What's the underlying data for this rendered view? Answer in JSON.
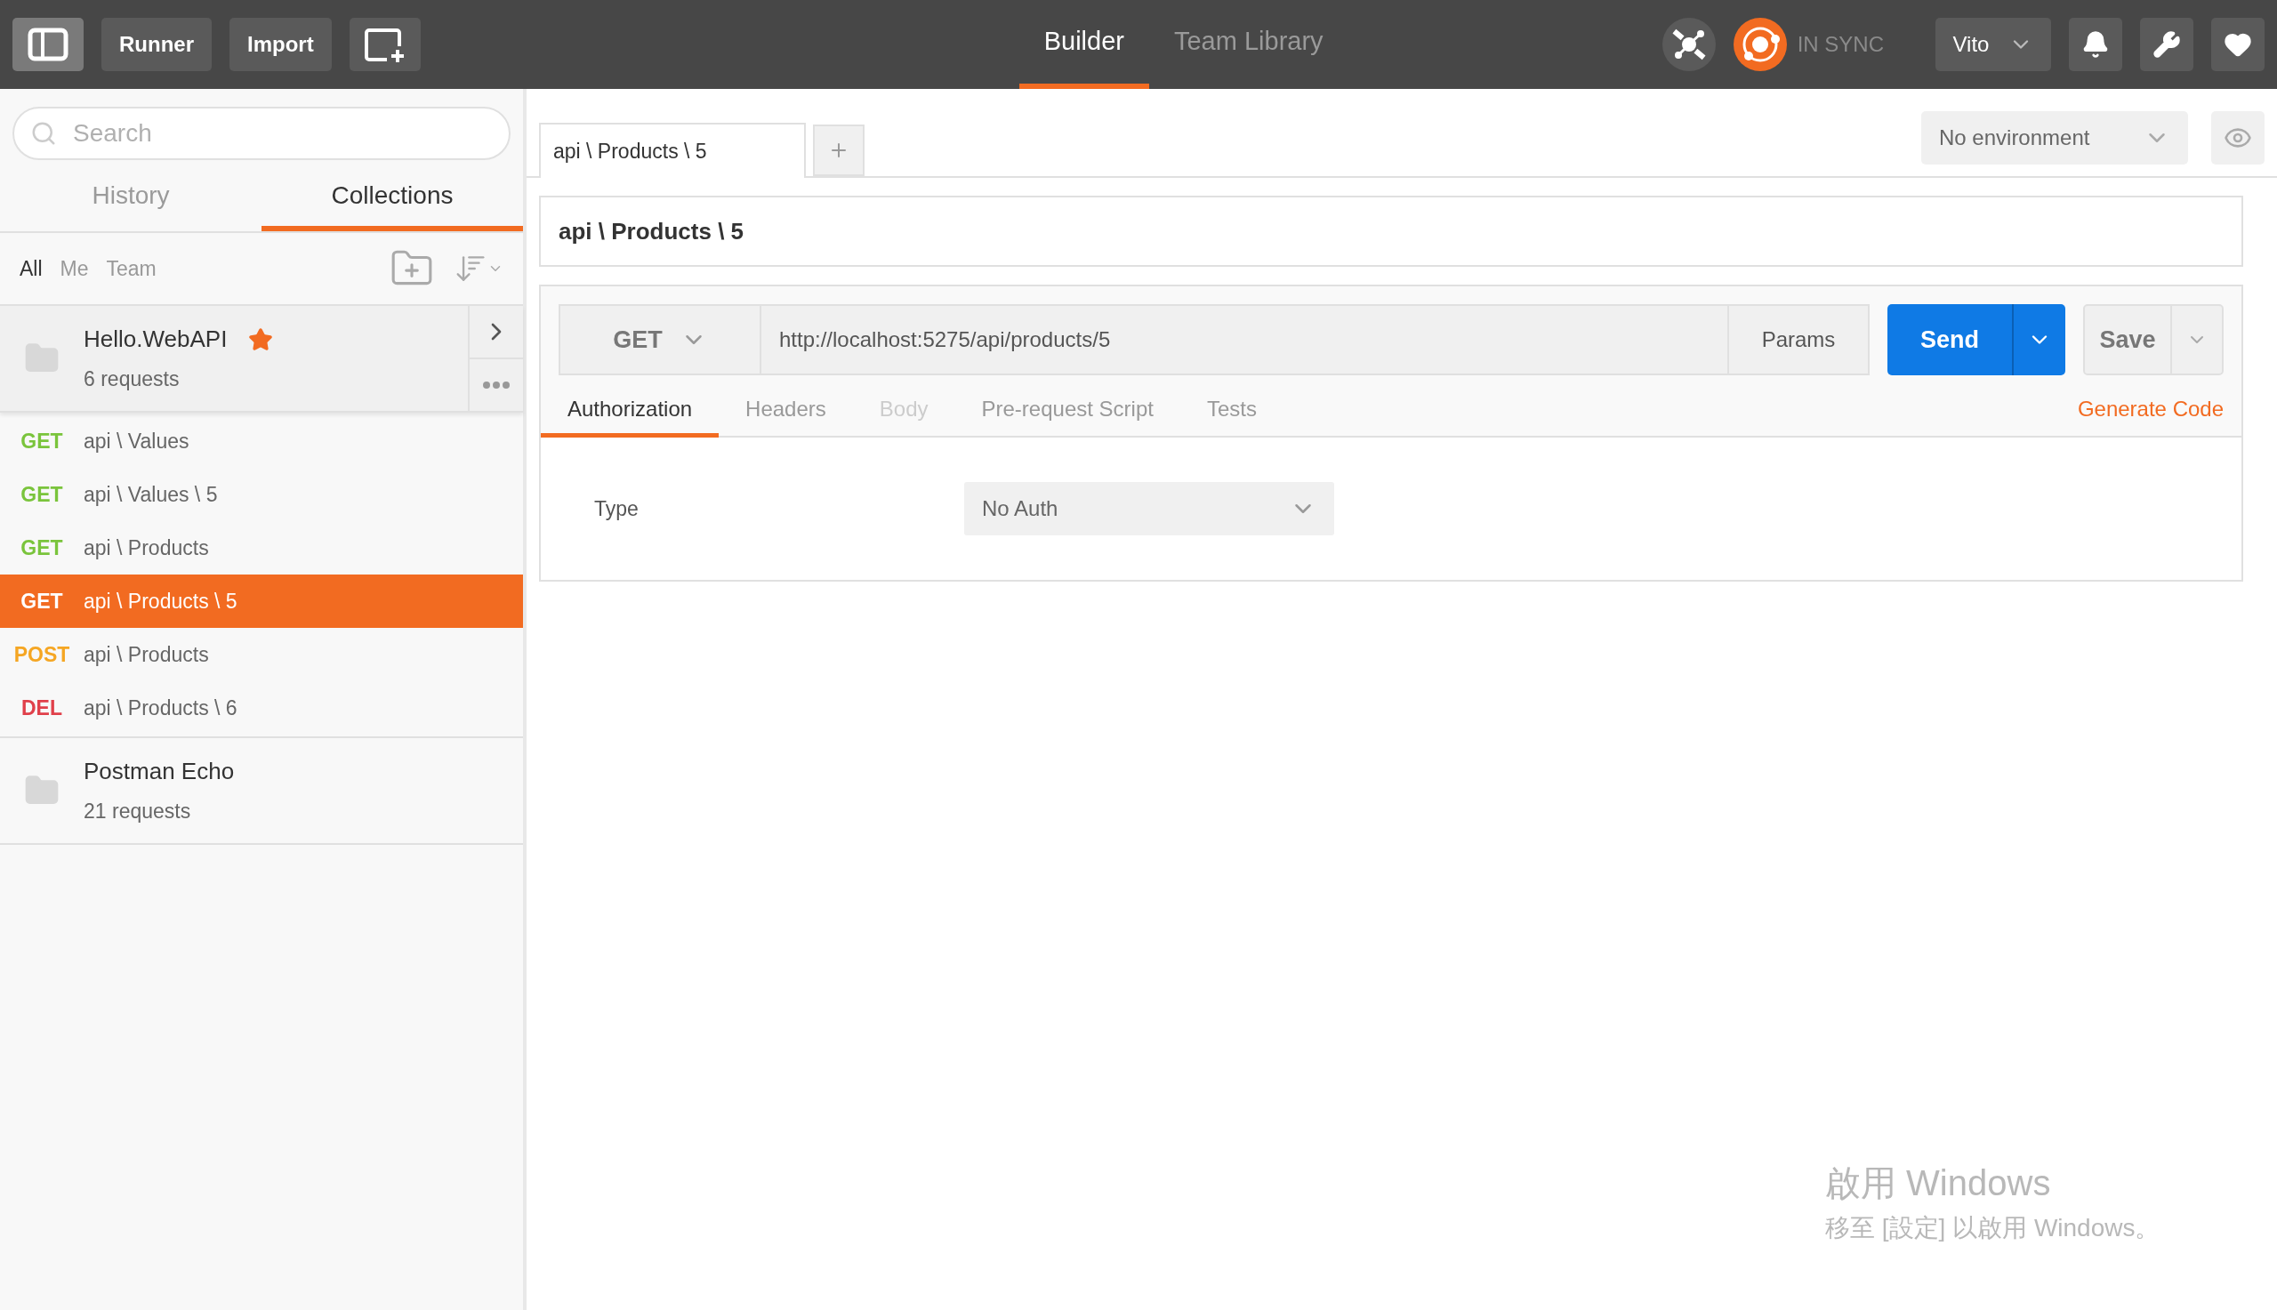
{
  "header": {
    "buttons": [
      "Runner",
      "Import"
    ],
    "tabs": [
      {
        "label": "Builder",
        "selected": true
      },
      {
        "label": "Team Library",
        "selected": false
      }
    ],
    "sync_status": "IN SYNC",
    "user": "Vito"
  },
  "sidebar": {
    "search": {
      "placeholder": "Search"
    },
    "tabs": [
      {
        "label": "History",
        "selected": false
      },
      {
        "label": "Collections",
        "selected": true
      }
    ],
    "filters": [
      {
        "label": "All",
        "selected": true
      },
      {
        "label": "Me",
        "selected": false
      },
      {
        "label": "Team",
        "selected": false
      }
    ],
    "collections": [
      {
        "name": "Hello.WebAPI",
        "count": "6 requests",
        "starred": true,
        "expanded": true,
        "requests": [
          {
            "method": "GET",
            "name": "api \\ Values",
            "selected": false,
            "color": "#7ac43c"
          },
          {
            "method": "GET",
            "name": "api \\ Values \\ 5",
            "selected": false,
            "color": "#7ac43c"
          },
          {
            "method": "GET",
            "name": "api \\ Products",
            "selected": false,
            "color": "#7ac43c"
          },
          {
            "method": "GET",
            "name": "api \\ Products \\ 5",
            "selected": true
          },
          {
            "method": "POST",
            "name": "api \\ Products",
            "selected": false,
            "color": "#f5a623"
          },
          {
            "method": "DEL",
            "name": "api \\ Products \\ 6",
            "selected": false,
            "color": "#e0404a"
          }
        ]
      },
      {
        "name": "Postman Echo",
        "count": "21 requests",
        "starred": false,
        "expanded": false
      }
    ]
  },
  "environment": "No environment",
  "request_tabs": [
    {
      "label": "api \\ Products \\ 5",
      "selected": true
    }
  ],
  "request_name": "api \\ Products \\ 5",
  "request": {
    "method": "GET",
    "url": "http://localhost:5275/api/products/5",
    "params": "Params",
    "send": "Send",
    "save": "Save"
  },
  "subtabs": [
    {
      "label": "Authorization",
      "selected": true,
      "disabled": false
    },
    {
      "label": "Headers",
      "selected": false,
      "disabled": false
    },
    {
      "label": "Body",
      "selected": false,
      "disabled": true
    },
    {
      "label": "Pre-request Script",
      "selected": false,
      "disabled": false
    },
    {
      "label": "Tests",
      "selected": false,
      "disabled": false
    }
  ],
  "generate_code": "Generate Code",
  "auth": {
    "label": "Type",
    "value": "No Auth"
  },
  "activation_notice": {
    "title": "啟用 Windows",
    "subtitle": "移至 [設定] 以啟用 Windows。"
  }
}
